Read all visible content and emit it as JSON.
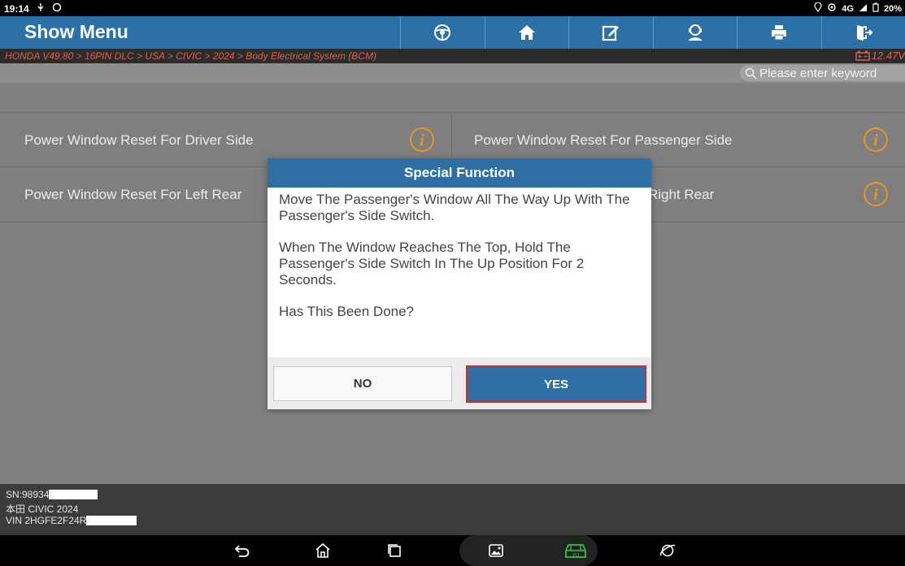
{
  "statusbar": {
    "time": "19:14",
    "network": "4G",
    "battery": "20%"
  },
  "header": {
    "title": "Show Menu",
    "tools": [
      "steering-wheel-icon",
      "home-icon",
      "edit-report-icon",
      "remote-support-icon",
      "print-icon",
      "exit-icon"
    ]
  },
  "breadcrumb": "HONDA V49.80 > 16PIN DLC > USA > CIVIC > 2024 > Body Electrical System (BCM)",
  "voltage": "12.47V",
  "search": {
    "placeholder": "Please enter keyword"
  },
  "menu": {
    "items": [
      {
        "label": "Power Window Reset For Driver Side"
      },
      {
        "label": "Power Window Reset For Passenger Side"
      },
      {
        "label": "Power Window Reset For Left Rear"
      },
      {
        "label": "Right Rear"
      }
    ]
  },
  "footer": {
    "sn": "SN:98934",
    "vehicle": "本田 CIVIC 2024",
    "vin": "VIN 2HGFE2F24R"
  },
  "dialog": {
    "title": "Special Function",
    "paragraphs": [
      "Move The Passenger's Window All The Way Up With The Passenger's Side Switch.",
      "When The Window Reaches The Top, Hold The Passenger's Side Switch In The Up Position For 2 Seconds.",
      "Has This Been Done?"
    ],
    "no_label": "NO",
    "yes_label": "YES"
  },
  "colors": {
    "accent": "#2b70a6",
    "highlight": "#d42a2a",
    "info": "#e8951c"
  }
}
